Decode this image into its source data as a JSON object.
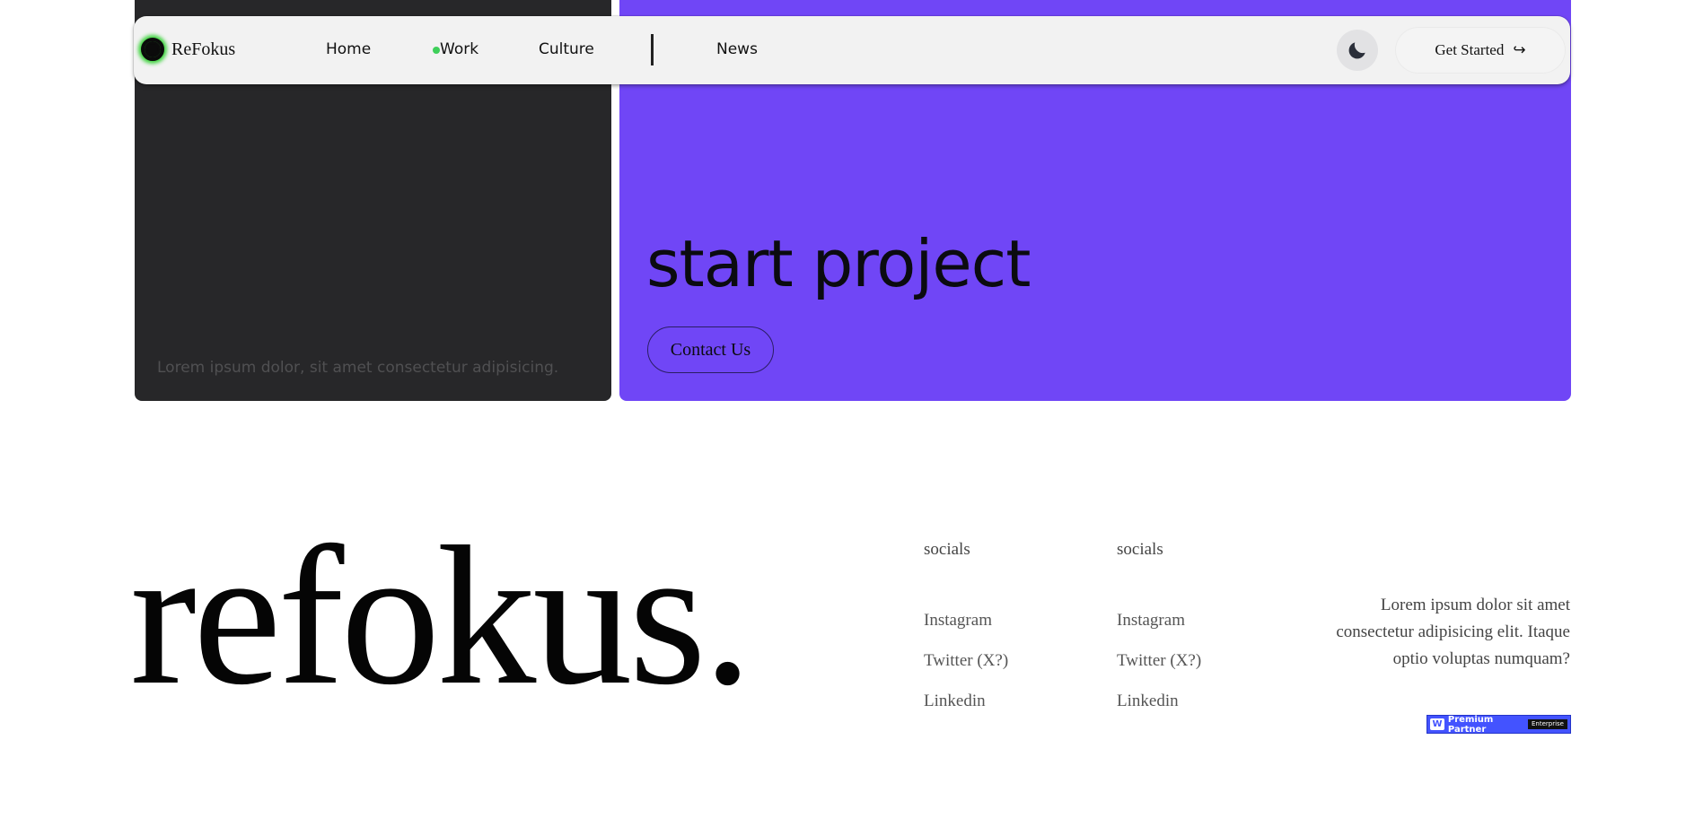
{
  "hero": {
    "dark_card_text": "Lorem ipsum dolor, sit amet consectetur adipisicing.",
    "headline": "start project",
    "contact_button": "Contact Us"
  },
  "navbar": {
    "logo_text": "ReFokus",
    "links": [
      {
        "label": "Home"
      },
      {
        "label": "Work",
        "active": true
      },
      {
        "label": "Culture"
      },
      {
        "label": "News"
      }
    ],
    "theme_toggle_icon": "moon-icon",
    "cta_label": "Get Started",
    "cta_icon": "arrow-right-icon",
    "cta_arrow": "↪"
  },
  "footer": {
    "big_logo": "refokus.",
    "columns": [
      {
        "heading": "socials",
        "links": [
          "Instagram",
          "Twitter (X?)",
          "Linkedin"
        ]
      },
      {
        "heading": "socials",
        "links": [
          "Instagram",
          "Twitter (X?)",
          "Linkedin"
        ]
      }
    ],
    "blurb": "Lorem ipsum dolor sit amet consectetur adipisicing elit. Itaque optio voluptas numquam?",
    "badge": {
      "logo_letter": "W",
      "label": "Premium Partner",
      "tag": "Enterprise"
    }
  },
  "colors": {
    "accent_purple": "#7046f6",
    "dark_card": "#272729",
    "status_green": "#3ecf5a",
    "badge_blue": "#4353ff"
  }
}
